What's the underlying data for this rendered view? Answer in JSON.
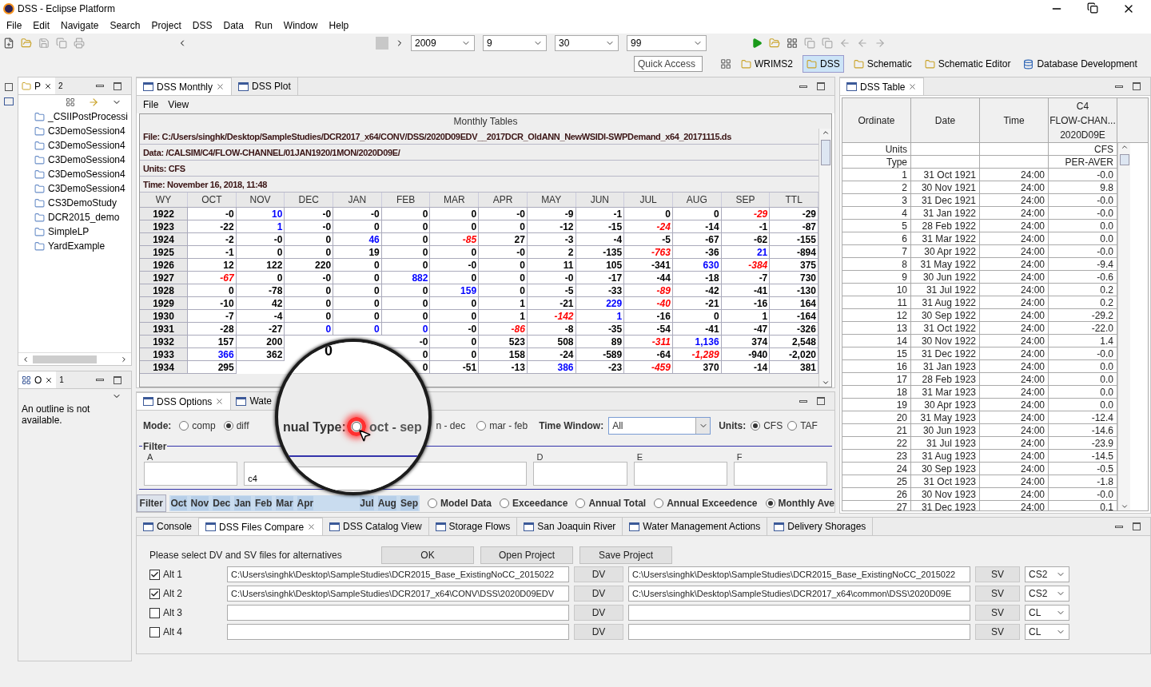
{
  "window": {
    "title": "DSS - Eclipse Platform"
  },
  "menu": [
    "File",
    "Edit",
    "Navigate",
    "Search",
    "Project",
    "DSS",
    "Data",
    "Run",
    "Window",
    "Help"
  ],
  "toolbar": {
    "combos": [
      "2009",
      "9",
      "30",
      "99"
    ],
    "quick_access": "Quick Access"
  },
  "perspectives": [
    {
      "label": "WRIMS2",
      "selected": false
    },
    {
      "label": "DSS",
      "selected": true
    },
    {
      "label": "Schematic",
      "selected": false
    },
    {
      "label": "Schematic Editor",
      "selected": false
    },
    {
      "label": "Database Development",
      "selected": false
    }
  ],
  "project_panel": {
    "tab": "P",
    "overflow_count": "2",
    "items": [
      "_CSIIPostProcessi",
      "C3DemoSession4",
      "C3DemoSession4",
      "C3DemoSession4",
      "C3DemoSession4",
      "C3DemoSession4",
      "CS3DemoStudy",
      "DCR2015_demo",
      "SimpleLP",
      "YardExample"
    ]
  },
  "outline": {
    "tab": "O",
    "overflow_count": "1",
    "message": "An outline is not available."
  },
  "monthly": {
    "tabs": [
      {
        "label": "DSS Monthly",
        "selected": true
      },
      {
        "label": "DSS Plot",
        "selected": false
      }
    ],
    "menu": [
      "File",
      "View"
    ],
    "title": "Monthly Tables",
    "info": [
      "File: C:/Users/singhk/Desktop/SampleStudies/DCR2017_x64/CONV/DSS/2020D09EDV__2017DCR_OldANN_NewWSIDI-SWPDemand_x64_20171115.ds",
      "Data: /CALSIM/C4/FLOW-CHANNEL/01JAN1920/1MON/2020D09E/",
      "Units: CFS",
      "Time: November 16, 2018, 11:48"
    ],
    "columns": [
      "WY",
      "OCT",
      "NOV",
      "DEC",
      "JAN",
      "FEB",
      "MAR",
      "APR",
      "MAY",
      "JUN",
      "JUL",
      "AUG",
      "SEP",
      "TTL"
    ],
    "rows": [
      {
        "wy": "1922",
        "cells": [
          {
            "v": "-0",
            "kind": "plain"
          },
          {
            "v": "10",
            "kind": "high"
          },
          {
            "v": "-0",
            "kind": "plain"
          },
          {
            "v": "-0",
            "kind": "plain"
          },
          {
            "v": "0",
            "kind": "plain"
          },
          {
            "v": "0",
            "kind": "plain"
          },
          {
            "v": "-0",
            "kind": "plain"
          },
          {
            "v": "-9",
            "kind": "plain"
          },
          {
            "v": "-1",
            "kind": "plain"
          },
          {
            "v": "0",
            "kind": "plain"
          },
          {
            "v": "0",
            "kind": "plain"
          },
          {
            "v": "-29",
            "kind": "low"
          },
          {
            "v": "-29",
            "kind": "plain"
          }
        ]
      },
      {
        "wy": "1923",
        "cells": [
          {
            "v": "-22",
            "kind": "plain"
          },
          {
            "v": "1",
            "kind": "high"
          },
          {
            "v": "-0",
            "kind": "plain"
          },
          {
            "v": "0",
            "kind": "plain"
          },
          {
            "v": "0",
            "kind": "plain"
          },
          {
            "v": "0",
            "kind": "plain"
          },
          {
            "v": "0",
            "kind": "plain"
          },
          {
            "v": "-12",
            "kind": "plain"
          },
          {
            "v": "-15",
            "kind": "plain"
          },
          {
            "v": "-24",
            "kind": "low"
          },
          {
            "v": "-14",
            "kind": "plain"
          },
          {
            "v": "-1",
            "kind": "plain"
          },
          {
            "v": "-87",
            "kind": "plain"
          }
        ]
      },
      {
        "wy": "1924",
        "cells": [
          {
            "v": "-2",
            "kind": "plain"
          },
          {
            "v": "-0",
            "kind": "plain"
          },
          {
            "v": "0",
            "kind": "plain"
          },
          {
            "v": "46",
            "kind": "high"
          },
          {
            "v": "0",
            "kind": "plain"
          },
          {
            "v": "-85",
            "kind": "low"
          },
          {
            "v": "27",
            "kind": "plain"
          },
          {
            "v": "-3",
            "kind": "plain"
          },
          {
            "v": "-4",
            "kind": "plain"
          },
          {
            "v": "-5",
            "kind": "plain"
          },
          {
            "v": "-67",
            "kind": "plain"
          },
          {
            "v": "-62",
            "kind": "plain"
          },
          {
            "v": "-155",
            "kind": "plain"
          }
        ]
      },
      {
        "wy": "1925",
        "cells": [
          {
            "v": "-1",
            "kind": "plain"
          },
          {
            "v": "0",
            "kind": "plain"
          },
          {
            "v": "0",
            "kind": "plain"
          },
          {
            "v": "19",
            "kind": "plain"
          },
          {
            "v": "0",
            "kind": "plain"
          },
          {
            "v": "0",
            "kind": "plain"
          },
          {
            "v": "-0",
            "kind": "plain"
          },
          {
            "v": "2",
            "kind": "plain"
          },
          {
            "v": "-135",
            "kind": "plain"
          },
          {
            "v": "-763",
            "kind": "low"
          },
          {
            "v": "-36",
            "kind": "plain"
          },
          {
            "v": "21",
            "kind": "high"
          },
          {
            "v": "-894",
            "kind": "plain"
          }
        ]
      },
      {
        "wy": "1926",
        "cells": [
          {
            "v": "12",
            "kind": "plain"
          },
          {
            "v": "122",
            "kind": "plain"
          },
          {
            "v": "220",
            "kind": "plain"
          },
          {
            "v": "0",
            "kind": "plain"
          },
          {
            "v": "0",
            "kind": "plain"
          },
          {
            "v": "-0",
            "kind": "plain"
          },
          {
            "v": "0",
            "kind": "plain"
          },
          {
            "v": "11",
            "kind": "plain"
          },
          {
            "v": "105",
            "kind": "plain"
          },
          {
            "v": "-341",
            "kind": "plain"
          },
          {
            "v": "630",
            "kind": "high"
          },
          {
            "v": "-384",
            "kind": "low"
          },
          {
            "v": "375",
            "kind": "plain"
          }
        ]
      },
      {
        "wy": "1927",
        "cells": [
          {
            "v": "-67",
            "kind": "low"
          },
          {
            "v": "0",
            "kind": "plain"
          },
          {
            "v": "-0",
            "kind": "plain"
          },
          {
            "v": "0",
            "kind": "plain"
          },
          {
            "v": "882",
            "kind": "high"
          },
          {
            "v": "0",
            "kind": "plain"
          },
          {
            "v": "0",
            "kind": "plain"
          },
          {
            "v": "-0",
            "kind": "plain"
          },
          {
            "v": "-17",
            "kind": "plain"
          },
          {
            "v": "-44",
            "kind": "plain"
          },
          {
            "v": "-18",
            "kind": "plain"
          },
          {
            "v": "-7",
            "kind": "plain"
          },
          {
            "v": "730",
            "kind": "plain"
          }
        ]
      },
      {
        "wy": "1928",
        "cells": [
          {
            "v": "0",
            "kind": "plain"
          },
          {
            "v": "-78",
            "kind": "plain"
          },
          {
            "v": "0",
            "kind": "plain"
          },
          {
            "v": "0",
            "kind": "plain"
          },
          {
            "v": "0",
            "kind": "plain"
          },
          {
            "v": "159",
            "kind": "high"
          },
          {
            "v": "0",
            "kind": "plain"
          },
          {
            "v": "-5",
            "kind": "plain"
          },
          {
            "v": "-33",
            "kind": "plain"
          },
          {
            "v": "-89",
            "kind": "low"
          },
          {
            "v": "-42",
            "kind": "plain"
          },
          {
            "v": "-41",
            "kind": "plain"
          },
          {
            "v": "-130",
            "kind": "plain"
          }
        ]
      },
      {
        "wy": "1929",
        "cells": [
          {
            "v": "-10",
            "kind": "plain"
          },
          {
            "v": "42",
            "kind": "plain"
          },
          {
            "v": "0",
            "kind": "plain"
          },
          {
            "v": "0",
            "kind": "plain"
          },
          {
            "v": "0",
            "kind": "plain"
          },
          {
            "v": "0",
            "kind": "plain"
          },
          {
            "v": "1",
            "kind": "plain"
          },
          {
            "v": "-21",
            "kind": "plain"
          },
          {
            "v": "229",
            "kind": "high"
          },
          {
            "v": "-40",
            "kind": "low"
          },
          {
            "v": "-21",
            "kind": "plain"
          },
          {
            "v": "-16",
            "kind": "plain"
          },
          {
            "v": "164",
            "kind": "plain"
          }
        ]
      },
      {
        "wy": "1930",
        "cells": [
          {
            "v": "-7",
            "kind": "plain"
          },
          {
            "v": "-4",
            "kind": "plain"
          },
          {
            "v": "0",
            "kind": "plain"
          },
          {
            "v": "0",
            "kind": "plain"
          },
          {
            "v": "0",
            "kind": "plain"
          },
          {
            "v": "0",
            "kind": "plain"
          },
          {
            "v": "1",
            "kind": "plain"
          },
          {
            "v": "-142",
            "kind": "low"
          },
          {
            "v": "1",
            "kind": "high"
          },
          {
            "v": "-16",
            "kind": "plain"
          },
          {
            "v": "0",
            "kind": "plain"
          },
          {
            "v": "1",
            "kind": "plain"
          },
          {
            "v": "-164",
            "kind": "plain"
          }
        ]
      },
      {
        "wy": "1931",
        "cells": [
          {
            "v": "-28",
            "kind": "plain"
          },
          {
            "v": "-27",
            "kind": "plain"
          },
          {
            "v": "0",
            "kind": "high"
          },
          {
            "v": "0",
            "kind": "high"
          },
          {
            "v": "0",
            "kind": "high"
          },
          {
            "v": "-0",
            "kind": "plain"
          },
          {
            "v": "-86",
            "kind": "low"
          },
          {
            "v": "-8",
            "kind": "plain"
          },
          {
            "v": "-35",
            "kind": "plain"
          },
          {
            "v": "-54",
            "kind": "plain"
          },
          {
            "v": "-41",
            "kind": "plain"
          },
          {
            "v": "-47",
            "kind": "plain"
          },
          {
            "v": "-326",
            "kind": "plain"
          }
        ]
      },
      {
        "wy": "1932",
        "cells": [
          {
            "v": "157",
            "kind": "plain"
          },
          {
            "v": "200",
            "kind": "plain"
          },
          {
            "kind": "covered"
          },
          {
            "kind": "covered"
          },
          {
            "v": "-0",
            "kind": "plain"
          },
          {
            "v": "0",
            "kind": "plain"
          },
          {
            "v": "523",
            "kind": "plain"
          },
          {
            "v": "508",
            "kind": "plain"
          },
          {
            "v": "89",
            "kind": "plain"
          },
          {
            "v": "-311",
            "kind": "low"
          },
          {
            "v": "1,136",
            "kind": "high"
          },
          {
            "v": "374",
            "kind": "plain"
          },
          {
            "v": "2,548",
            "kind": "plain"
          }
        ]
      },
      {
        "wy": "1933",
        "cells": [
          {
            "v": "366",
            "kind": "high"
          },
          {
            "v": "362",
            "kind": "plain"
          },
          {
            "kind": "covered"
          },
          {
            "kind": "covered"
          },
          {
            "v": "0",
            "kind": "plain"
          },
          {
            "v": "0",
            "kind": "plain"
          },
          {
            "v": "158",
            "kind": "plain"
          },
          {
            "v": "-24",
            "kind": "plain"
          },
          {
            "v": "-589",
            "kind": "plain"
          },
          {
            "v": "-64",
            "kind": "plain"
          },
          {
            "v": "-1,289",
            "kind": "low"
          },
          {
            "v": "-940",
            "kind": "plain"
          },
          {
            "v": "-2,020",
            "kind": "plain"
          }
        ]
      },
      {
        "wy": "1934",
        "cells": [
          {
            "v": "295",
            "kind": "plain"
          },
          {
            "kind": "covered"
          },
          {
            "kind": "covered"
          },
          {
            "kind": "covered"
          },
          {
            "v": "0",
            "kind": "plain"
          },
          {
            "v": "-51",
            "kind": "plain"
          },
          {
            "v": "-13",
            "kind": "plain"
          },
          {
            "v": "386",
            "kind": "high"
          },
          {
            "v": "-23",
            "kind": "plain"
          },
          {
            "v": "-459",
            "kind": "low"
          },
          {
            "v": "370",
            "kind": "plain"
          },
          {
            "v": "-14",
            "kind": "plain"
          },
          {
            "v": "381",
            "kind": "plain"
          }
        ]
      }
    ]
  },
  "options": {
    "tabs": [
      {
        "label": "DSS Options",
        "selected": true
      },
      {
        "label": "Wate",
        "selected": false
      }
    ],
    "mode": {
      "label": "Mode:",
      "options": [
        {
          "label": "comp",
          "selected": false
        },
        {
          "label": "diff",
          "selected": true
        }
      ]
    },
    "annual_partial": "n - dec",
    "annual_options": [
      {
        "label": "mar - feb",
        "selected": false
      }
    ],
    "time_window": {
      "label": "Time Window:",
      "value": "All"
    },
    "units": {
      "label": "Units:",
      "options": [
        {
          "label": "CFS",
          "selected": true
        },
        {
          "label": "TAF",
          "selected": false
        }
      ]
    },
    "filter": {
      "title": "Filter",
      "fields": [
        {
          "label": "A"
        },
        {
          "label": "D"
        },
        {
          "label": "E"
        },
        {
          "label": "F"
        }
      ],
      "b_value": "c4"
    },
    "filter_button": "Filter",
    "months": [
      {
        "label": "Oct",
        "selected": true
      },
      {
        "label": "Nov",
        "selected": true
      },
      {
        "label": "Dec",
        "selected": true
      },
      {
        "label": "Jan",
        "selected": true
      },
      {
        "label": "Feb",
        "selected": true
      },
      {
        "label": "Mar",
        "selected": true
      },
      {
        "label": "Apr",
        "selected": true
      },
      {
        "label": "Jul",
        "selected": true
      },
      {
        "label": "Aug",
        "selected": true
      },
      {
        "label": "Sep",
        "selected": true
      }
    ],
    "views": [
      {
        "label": "Model Data",
        "selected": false
      },
      {
        "label": "Exceedance",
        "selected": false
      },
      {
        "label": "Annual Total",
        "selected": false
      },
      {
        "label": "Annual Exceedence",
        "selected": false
      },
      {
        "label": "Monthly Ave",
        "selected": true
      }
    ]
  },
  "magnifier": {
    "label": "nual Type:",
    "option": "oct - sep",
    "selected": false,
    "cell": "0"
  },
  "dss_table": {
    "tab": "DSS Table",
    "columns": [
      {
        "lines": [
          "Ordinate"
        ]
      },
      {
        "lines": [
          "Date"
        ]
      },
      {
        "lines": [
          "Time"
        ]
      },
      {
        "lines": [
          "C4",
          "FLOW-CHAN...",
          "2020D09E"
        ]
      }
    ],
    "meta": [
      [
        "Units",
        "CFS"
      ],
      [
        "Type",
        "PER-AVER"
      ]
    ],
    "rows": [
      [
        "1",
        "31 Oct 1921",
        "24:00",
        "-0.0"
      ],
      [
        "2",
        "30 Nov 1921",
        "24:00",
        "9.8"
      ],
      [
        "3",
        "31 Dec 1921",
        "24:00",
        "-0.0"
      ],
      [
        "4",
        "31 Jan 1922",
        "24:00",
        "-0.0"
      ],
      [
        "5",
        "28 Feb 1922",
        "24:00",
        "0.0"
      ],
      [
        "6",
        "31 Mar 1922",
        "24:00",
        "0.0"
      ],
      [
        "7",
        "30 Apr 1922",
        "24:00",
        "-0.0"
      ],
      [
        "8",
        "31 May 1922",
        "24:00",
        "-9.4"
      ],
      [
        "9",
        "30 Jun 1922",
        "24:00",
        "-0.6"
      ],
      [
        "10",
        "31 Jul 1922",
        "24:00",
        "0.2"
      ],
      [
        "11",
        "31 Aug 1922",
        "24:00",
        "0.2"
      ],
      [
        "12",
        "30 Sep 1922",
        "24:00",
        "-29.2"
      ],
      [
        "13",
        "31 Oct 1922",
        "24:00",
        "-22.0"
      ],
      [
        "14",
        "30 Nov 1922",
        "24:00",
        "1.4"
      ],
      [
        "15",
        "31 Dec 1922",
        "24:00",
        "-0.0"
      ],
      [
        "16",
        "31 Jan 1923",
        "24:00",
        "0.0"
      ],
      [
        "17",
        "28 Feb 1923",
        "24:00",
        "0.0"
      ],
      [
        "18",
        "31 Mar 1923",
        "24:00",
        "0.0"
      ],
      [
        "19",
        "30 Apr 1923",
        "24:00",
        "0.0"
      ],
      [
        "20",
        "31 May 1923",
        "24:00",
        "-12.4"
      ],
      [
        "21",
        "30 Jun 1923",
        "24:00",
        "-14.6"
      ],
      [
        "22",
        "31 Jul 1923",
        "24:00",
        "-23.9"
      ],
      [
        "23",
        "31 Aug 1923",
        "24:00",
        "-14.5"
      ],
      [
        "24",
        "30 Sep 1923",
        "24:00",
        "-0.5"
      ],
      [
        "25",
        "31 Oct 1923",
        "24:00",
        "-1.8"
      ],
      [
        "26",
        "30 Nov 1923",
        "24:00",
        "-0.0"
      ],
      [
        "27",
        "31 Dec 1923",
        "24:00",
        "0.1"
      ]
    ]
  },
  "bottom": {
    "tabs": [
      {
        "label": "Console",
        "selected": false
      },
      {
        "label": "DSS Files Compare",
        "selected": true
      },
      {
        "label": "DSS Catalog View",
        "selected": false
      },
      {
        "label": "Storage Flows",
        "selected": false
      },
      {
        "label": "San Joaquin River",
        "selected": false
      },
      {
        "label": "Water Management Actions",
        "selected": false
      },
      {
        "label": "Delivery Shorages",
        "selected": false
      }
    ],
    "prompt": "Please select DV and SV files for alternatives",
    "buttons": [
      "OK",
      "Open Project",
      "Save Project"
    ],
    "alts": [
      {
        "label": "Alt 1",
        "checked": true,
        "dv": "C:\\Users\\singhk\\Desktop\\SampleStudies\\DCR2015_Base_ExistingNoCC_2015022",
        "dv_button": "DV",
        "sv": "C:\\Users\\singhk\\Desktop\\SampleStudies\\DCR2015_Base_ExistingNoCC_2015022",
        "sv_button": "SV",
        "choice": "CS2"
      },
      {
        "label": "Alt 2",
        "checked": true,
        "dv": "C:\\Users\\singhk\\Desktop\\SampleStudies\\DCR2017_x64\\CONV\\DSS\\2020D09EDV",
        "dv_button": "DV",
        "sv": "C:\\Users\\singhk\\Desktop\\SampleStudies\\DCR2017_x64\\common\\DSS\\2020D09E",
        "sv_button": "SV",
        "choice": "CS2"
      },
      {
        "label": "Alt 3",
        "checked": false,
        "dv_button": "DV",
        "sv_button": "SV",
        "choice": "CL"
      },
      {
        "label": "Alt 4",
        "checked": false,
        "dv_button": "DV",
        "sv_button": "SV",
        "choice": "CL"
      }
    ]
  }
}
